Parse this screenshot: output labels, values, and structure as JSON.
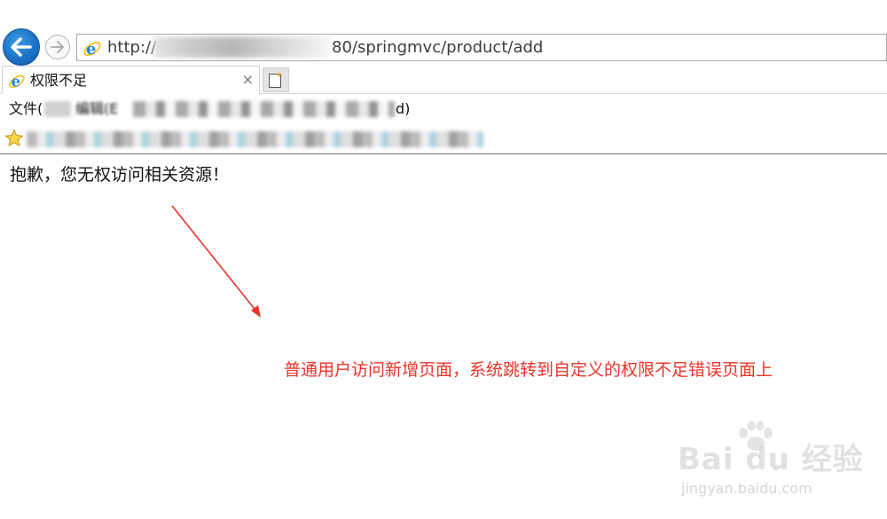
{
  "browser": {
    "address_prefix": "http://",
    "address_suffix": "80/springmvc/product/add",
    "tab_title": "权限不足",
    "tab_close": "×",
    "menu_file": "文件(",
    "menu_edit": "编辑(E",
    "menu_end": "d)"
  },
  "icons": {
    "back": "back-arrow-icon",
    "forward": "forward-arrow-icon",
    "ie": "internet-explorer-icon",
    "new_tab": "new-tab-icon",
    "favorites": "favorites-star-icon"
  },
  "page": {
    "message": "抱歉，您无权访问相关资源！"
  },
  "annotation": {
    "text": "普通用户访问新增页面，系统跳转到自定义的权限不足错误页面上",
    "color": "#e8342b"
  },
  "watermark": {
    "brand": "Bai du 经验",
    "url": "jingyan.baidu.com"
  },
  "colors": {
    "back_button": "#1a6fc2",
    "annotation": "#e8342b"
  }
}
